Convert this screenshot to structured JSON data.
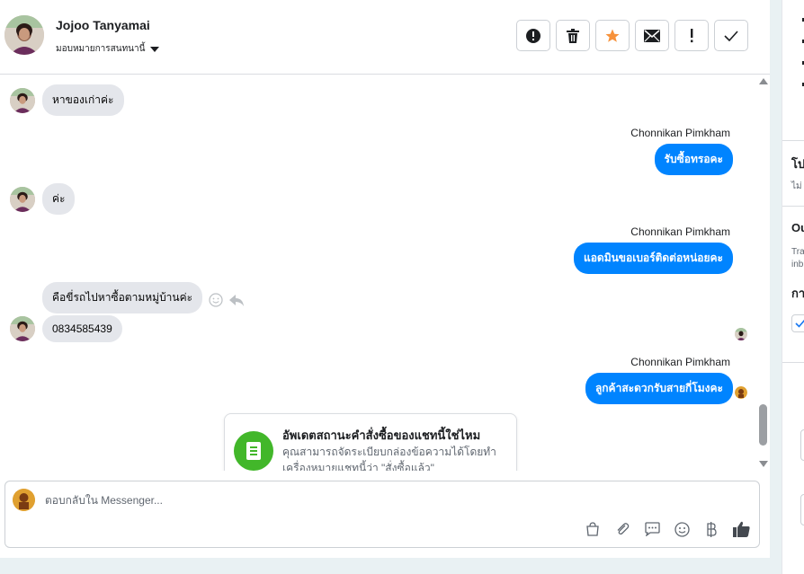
{
  "header": {
    "contact_name": "Jojoo Tanyamai",
    "assign_label": "มอบหมายการสนทนานี้",
    "actions": [
      {
        "name": "spam-icon",
        "label": "!"
      },
      {
        "name": "trash-icon",
        "label": ""
      },
      {
        "name": "star-icon",
        "label": ""
      },
      {
        "name": "mail-icon",
        "label": ""
      },
      {
        "name": "exclamation-icon",
        "label": "!"
      },
      {
        "name": "check-icon",
        "label": ""
      }
    ]
  },
  "messages": {
    "m1": "หาของเก่าค่ะ",
    "sender1": "Chonnikan Pimkham",
    "m2": "รับซื้อทรอคะ",
    "m3": "ค่ะ",
    "sender2": "Chonnikan Pimkham",
    "m4": "แอดมินขอเบอร์ติดต่อหน่อยคะ",
    "m5": "คือขี่รถไปหาซื้อตามหมู่บ้านค่ะ",
    "m6": "0834585439",
    "sender3": "Chonnikan Pimkham",
    "m7": "ลูกค้าสะดวกรับสายกี่โมงคะ"
  },
  "order_card": {
    "title": "อัพเดตสถานะคำสั่งซื้อของแชทนี้ใช่ไหม",
    "body": "คุณสามารถจัดระเบียบกล่องข้อความได้โดยทำเครื่องหมายแชทนี้ว่า \"สั่งซื้อแล้ว\""
  },
  "composer": {
    "placeholder": "ตอบกลับใน Messenger...",
    "tools": [
      "bag-icon",
      "paperclip-icon",
      "saved-reply-icon",
      "emoji-icon",
      "baht-icon",
      "like-icon"
    ]
  },
  "right_panel": {
    "line1": "โป",
    "line2": "ไม่",
    "line3": "Ou",
    "line4": "Tra",
    "line5": "inb",
    "line6": "กา"
  },
  "colors": {
    "accent": "#0084ff",
    "incoming_bubble": "#e4e6eb",
    "star": "#f7923b",
    "card_icon": "#42b72a"
  }
}
